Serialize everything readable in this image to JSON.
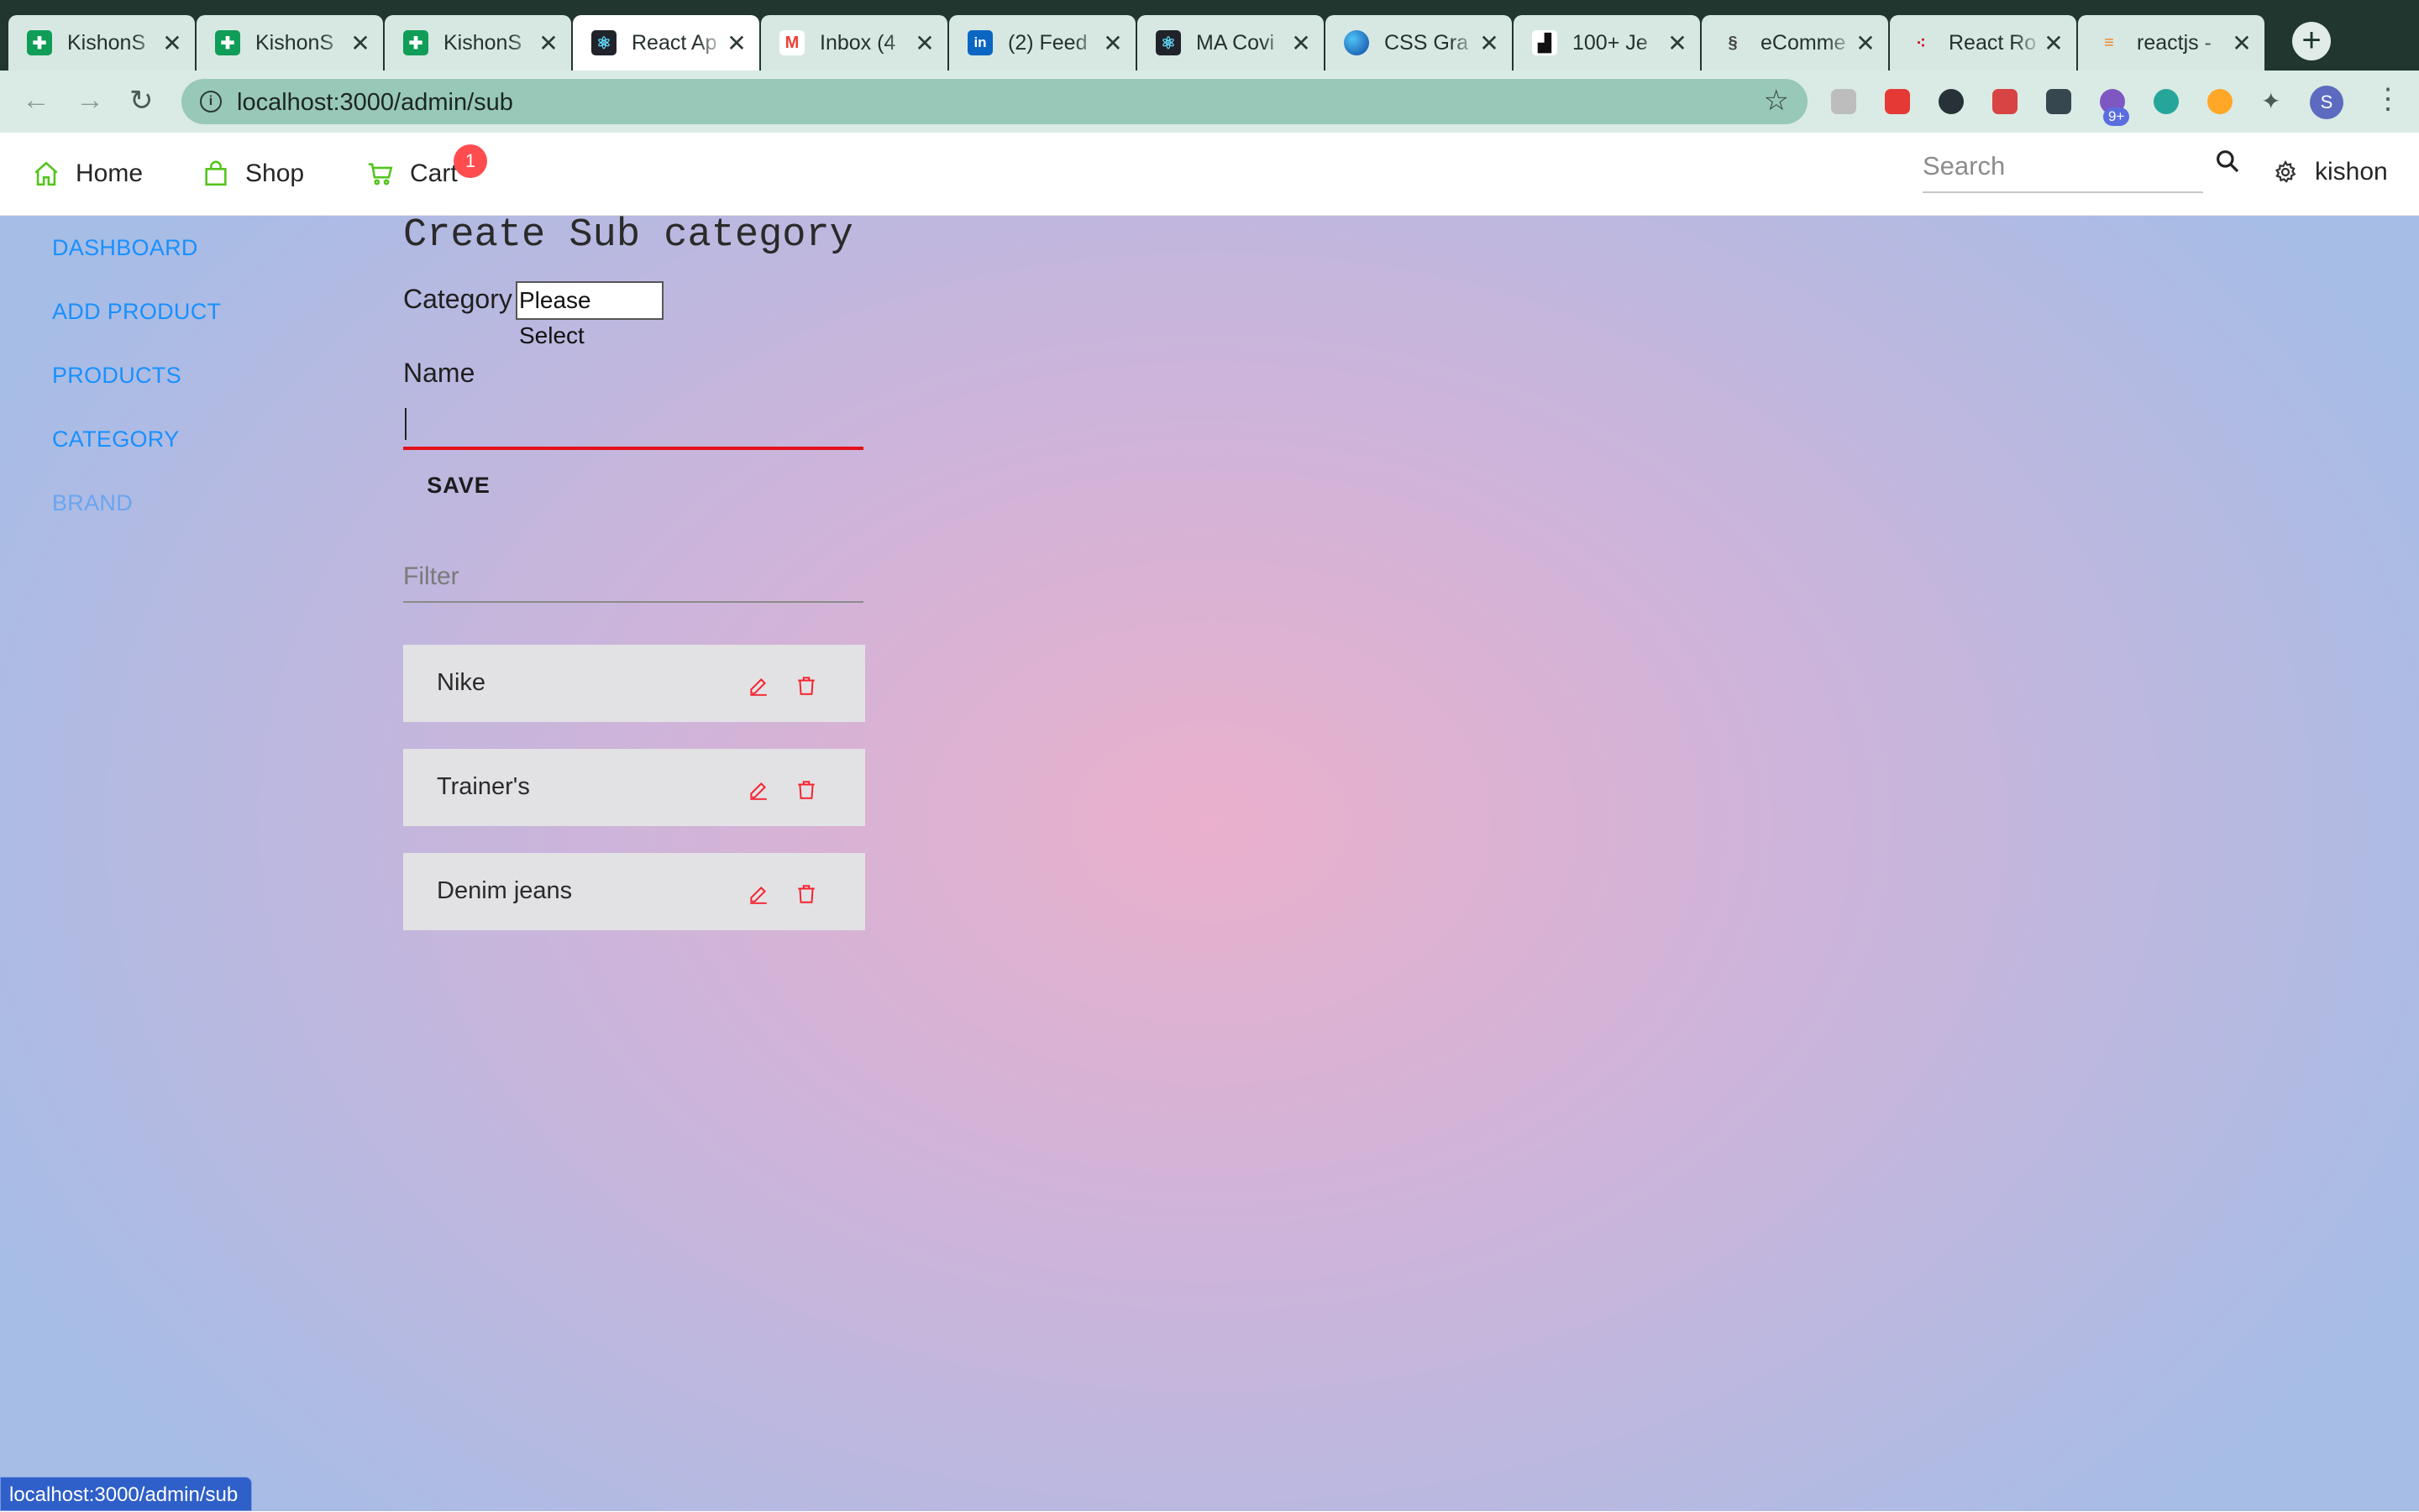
{
  "browser": {
    "tabs": [
      {
        "title": "KishonS",
        "favicon": "google-sheets-icon",
        "color": "#0f9d58"
      },
      {
        "title": "KishonS",
        "favicon": "google-sheets-icon",
        "color": "#0f9d58"
      },
      {
        "title": "KishonS",
        "favicon": "google-sheets-icon",
        "color": "#0f9d58"
      },
      {
        "title": "React Ap",
        "favicon": "react-icon",
        "color": "#20232a",
        "active": true
      },
      {
        "title": "Inbox (4",
        "favicon": "gmail-icon",
        "color": "#ea4335"
      },
      {
        "title": "(2) Feed",
        "favicon": "linkedin-icon",
        "color": "#0a66c2"
      },
      {
        "title": "MA Covi",
        "favicon": "react-icon",
        "color": "#20232a"
      },
      {
        "title": "CSS Gra",
        "favicon": "css-gradient-icon",
        "color": "#1565c0"
      },
      {
        "title": "100+ Je",
        "favicon": "unsplash-icon",
        "color": "#111111"
      },
      {
        "title": "eComme",
        "favicon": "squarespace-icon",
        "color": "#555555"
      },
      {
        "title": "React Ro",
        "favicon": "react-router-icon",
        "color": "#d0021b"
      },
      {
        "title": "reactjs -",
        "favicon": "stackoverflow-icon",
        "color": "#f48024"
      }
    ],
    "url": "localhost:3000/admin/sub",
    "extension_badge": "9+",
    "profile_initial": "S",
    "status_url": "localhost:3000/admin/sub"
  },
  "header": {
    "home": "Home",
    "shop": "Shop",
    "cart": "Cart",
    "cart_count": "1",
    "search_placeholder": "Search",
    "user": "kishon"
  },
  "sidebar": {
    "items": [
      {
        "label": "DASHBOARD"
      },
      {
        "label": "ADD PRODUCT"
      },
      {
        "label": "PRODUCTS"
      },
      {
        "label": "CATEGORY"
      },
      {
        "label": "BRAND"
      }
    ]
  },
  "main": {
    "title": "Create Sub category",
    "category_label": "Category",
    "category_value": "Please Select",
    "name_label": "Name",
    "name_value": "",
    "save_label": "SAVE",
    "filter_placeholder": "Filter",
    "subs": [
      {
        "name": "Nike"
      },
      {
        "name": "Trainer's"
      },
      {
        "name": "Denim jeans"
      }
    ]
  },
  "colors": {
    "accent": "#1890ff",
    "danger": "#ff4d4f",
    "nav_icon": "#52c41a",
    "action_icon": "#f5222d"
  }
}
